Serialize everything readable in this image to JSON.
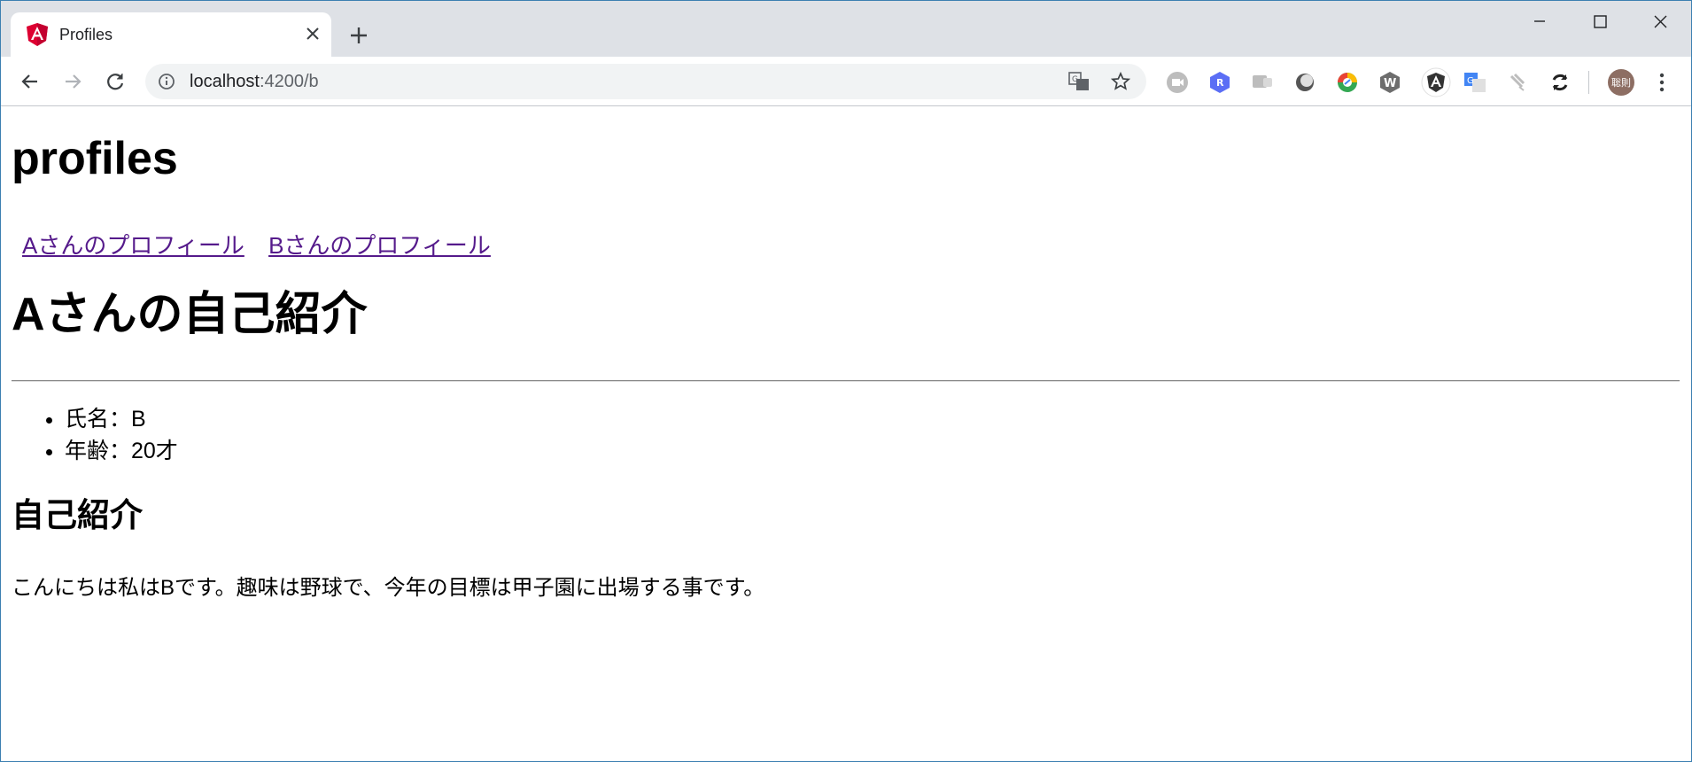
{
  "browser": {
    "tab_title": "Profiles",
    "url_host": "localhost",
    "url_rest": ":4200/b",
    "avatar_text": "聡則",
    "colors": {
      "tabstrip": "#dee1e6",
      "omnibox": "#f1f3f4",
      "link_visited": "#551a8b"
    },
    "icons": [
      "angular-favicon",
      "close-icon",
      "plus-icon",
      "back-icon",
      "forward-icon",
      "reload-icon",
      "info-icon",
      "translate-icon",
      "star-icon",
      "menu-icon"
    ],
    "extensions": [
      "ext-video-icon",
      "ext-r-icon",
      "ext-chat-icon",
      "ext-circle-icon",
      "ext-chrome-icon",
      "ext-w-icon",
      "ext-angular-icon",
      "ext-google-translate-icon",
      "ext-pin-icon",
      "ext-sync-icon"
    ]
  },
  "page": {
    "title": "profiles",
    "links": [
      "Aさんのプロフィール",
      "Bさんのプロフィール"
    ],
    "heading": "Aさんの自己紹介",
    "facts": [
      "氏名：B",
      "年齢：20才"
    ],
    "subheading": "自己紹介",
    "bio": "こんにちは私はBです。趣味は野球で、今年の目標は甲子園に出場する事です。"
  }
}
